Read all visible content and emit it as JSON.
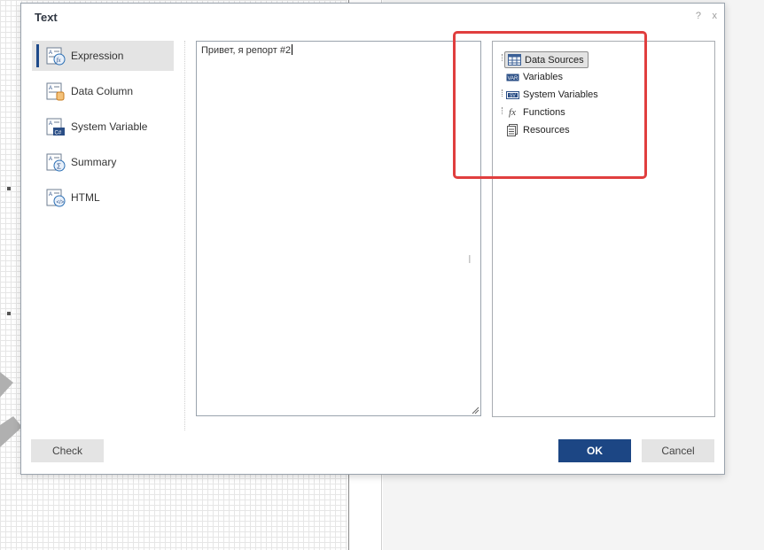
{
  "dialog": {
    "title": "Text",
    "help_label": "?",
    "close_label": "x"
  },
  "sidebar": {
    "items": [
      {
        "label": "Expression",
        "icon": "expression-icon"
      },
      {
        "label": "Data Column",
        "icon": "data-column-icon"
      },
      {
        "label": "System Variable",
        "icon": "system-variable-icon"
      },
      {
        "label": "Summary",
        "icon": "summary-icon"
      },
      {
        "label": "HTML",
        "icon": "html-icon"
      }
    ],
    "active_index": 0
  },
  "expression": {
    "value": "Привет, я репорт #2"
  },
  "tree": {
    "items": [
      {
        "label": "Data Sources",
        "icon": "data-sources-icon",
        "selected": true
      },
      {
        "label": "Variables",
        "icon": "variables-icon"
      },
      {
        "label": "System Variables",
        "icon": "system-variables-icon"
      },
      {
        "label": "Functions",
        "icon": "functions-icon"
      },
      {
        "label": "Resources",
        "icon": "resources-icon"
      }
    ]
  },
  "buttons": {
    "check": "Check",
    "ok": "OK",
    "cancel": "Cancel"
  },
  "colors": {
    "primary": "#1c4684",
    "highlight": "#e03e3e",
    "active_bar": "#1e4a8a"
  }
}
